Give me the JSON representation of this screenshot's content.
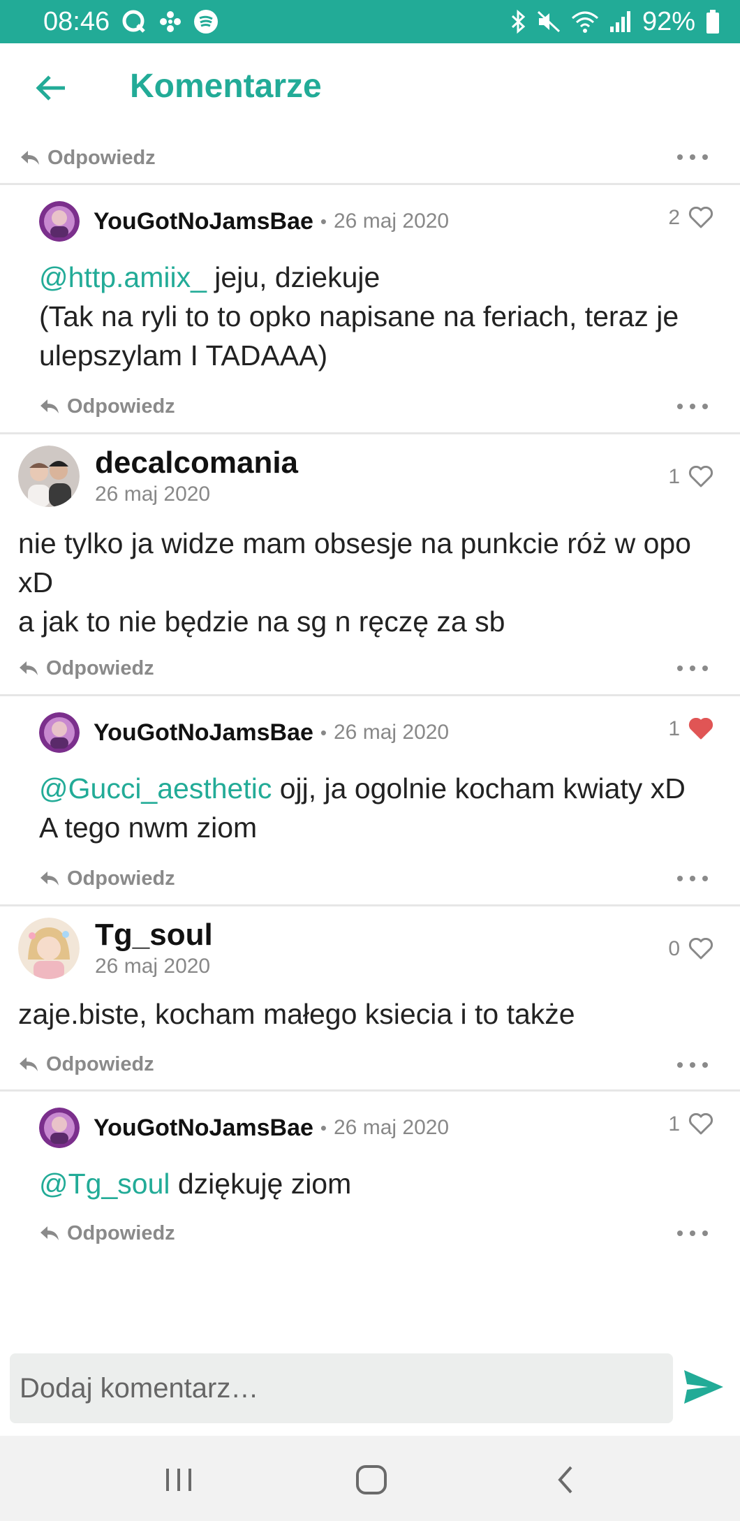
{
  "status_bar": {
    "time": "08:46",
    "battery": "92%",
    "left_icons": [
      "q-app-icon",
      "fan-icon",
      "spotify-icon"
    ],
    "right_icons": [
      "bluetooth-icon",
      "mute-icon",
      "wifi-icon",
      "signal-icon",
      "battery-icon"
    ]
  },
  "app_bar": {
    "title": "Komentarze",
    "back_icon": "arrow-left-icon"
  },
  "reply_label": "Odpowiedz",
  "comments": [
    {
      "kind": "nested",
      "user": "YouGotNoJamsBae",
      "date": "26 maj 2020",
      "likes": "2",
      "liked": false,
      "mention": "@http.amiix_",
      "lines": [
        " jeju, dziekuje",
        "(Tak na ryli to to opko napisane na feriach, teraz je ulepszylam I TADAAA)"
      ]
    },
    {
      "kind": "top",
      "user": "decalcomania",
      "date": "26 maj 2020",
      "likes": "1",
      "liked": false,
      "text": "nie tylko ja widze mam obsesje na punkcie róż w opo xD\na jak to nie będzie na sg n ręczę za sb"
    },
    {
      "kind": "nested",
      "user": "YouGotNoJamsBae",
      "date": "26 maj 2020",
      "likes": "1",
      "liked": true,
      "mention": "@Gucci_aesthetic",
      "lines": [
        " ojj, ja ogolnie kocham kwiaty xD",
        "A tego nwm ziom"
      ]
    },
    {
      "kind": "top",
      "user": "Tg_soul",
      "date": "26 maj 2020",
      "likes": "0",
      "liked": false,
      "text": "zaje.biste, kocham małego ksiecia i to także"
    },
    {
      "kind": "nested",
      "user": "YouGotNoJamsBae",
      "date": "26 maj 2020",
      "likes": "1",
      "liked": false,
      "mention": "@Tg_soul",
      "lines": [
        " dziękuję ziom"
      ]
    }
  ],
  "composer": {
    "placeholder": "Dodaj komentarz…",
    "send_icon": "send-icon"
  },
  "colors": {
    "accent": "#22ab97",
    "liked_heart": "#e05555",
    "muted": "#888888"
  },
  "nav_bar": {
    "icons": [
      "recent-apps-icon",
      "home-icon",
      "back-nav-icon"
    ]
  }
}
